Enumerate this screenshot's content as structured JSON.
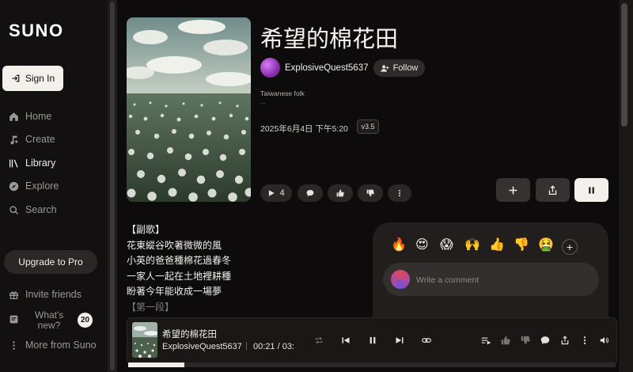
{
  "app": {
    "logo": "SUNO"
  },
  "sidebar": {
    "signin_label": "Sign In",
    "items": [
      {
        "label": "Home",
        "icon": "home-icon"
      },
      {
        "label": "Create",
        "icon": "music-note-icon"
      },
      {
        "label": "Library",
        "icon": "library-icon"
      },
      {
        "label": "Explore",
        "icon": "compass-icon"
      },
      {
        "label": "Search",
        "icon": "search-icon"
      }
    ],
    "upgrade_label": "Upgrade to Pro",
    "invite_label": "Invite friends",
    "whats_new_label": "What's new?",
    "whats_new_count": "20",
    "more_label": "More from Suno"
  },
  "song": {
    "title": "希望的棉花田",
    "artist": "ExplosiveQuest5637",
    "follow_label": "Follow",
    "genre": "Taiwanese folk",
    "genre_more": "...",
    "date": "2025年6月4日 下午5:20",
    "version": "v3.5",
    "play_count": "4"
  },
  "lyrics": {
    "lines": [
      "【副歌】",
      "花東縱谷吹著微微的風",
      "小英的爸爸種棉花過春冬",
      "一家人一起在土地裡耕種",
      "盼著今年能收成一場夢"
    ],
    "next_partial": "【第一段】"
  },
  "comments": {
    "emojis": [
      "🔥",
      "😍",
      "😱",
      "🙌",
      "👍",
      "👎",
      "🤮"
    ],
    "add_label": "+",
    "placeholder": "Write a comment"
  },
  "player": {
    "title": "希望的棉花田",
    "artist": "ExplosiveQuest5637",
    "separator": "|",
    "time": "00:21 / 03:",
    "progress": 0.115
  },
  "colors": {
    "background": "#0d0b0b",
    "sidebar": "#121010",
    "accent_light": "#f4f1ec",
    "pill": "#2a2726"
  }
}
